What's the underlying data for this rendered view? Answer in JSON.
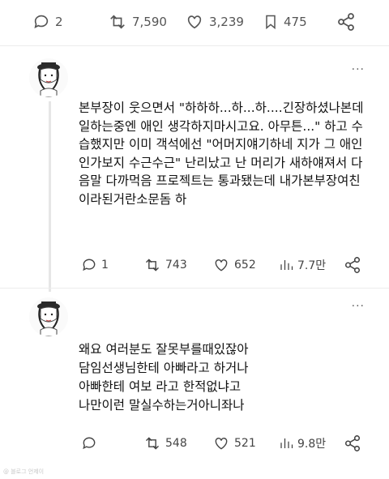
{
  "top_actions": {
    "replies": "2",
    "retweets": "7,590",
    "likes": "3,239",
    "bookmarks": "475"
  },
  "posts": [
    {
      "text": "본부장이 웃으면서 \"하하하...하...하....긴장하셨나본데 일하는중엔 애인 생각하지마시고요. 아무튼...\" 하고 수습했지만 이미 객석에선 \"어머지얘기하네 지가 그 애인인가보지 수근수근\" 난리났고 난 머리가 새하얘져서 다음말 다까먹음 프로젝트는 통과됐는데 내가본부장여친이라된거란소문돔 하",
      "replies": "1",
      "retweets": "743",
      "likes": "652",
      "views": "7.7만",
      "more": "···"
    },
    {
      "text": "왜요 여러분도 잘못부를때있잖아\n담임선생님한테 아빠라고 하거나\n아빠한테 여보 라고 한적없냐고\n나만이런 말실수하는거아니좌나",
      "replies": "",
      "retweets": "548",
      "likes": "521",
      "views": "9.8만",
      "more": "···"
    }
  ],
  "icons": [
    "reply-icon",
    "retweet-icon",
    "like-icon",
    "bookmark-icon",
    "share-icon",
    "views-icon"
  ],
  "watermark": "@ 블로그 언제이"
}
